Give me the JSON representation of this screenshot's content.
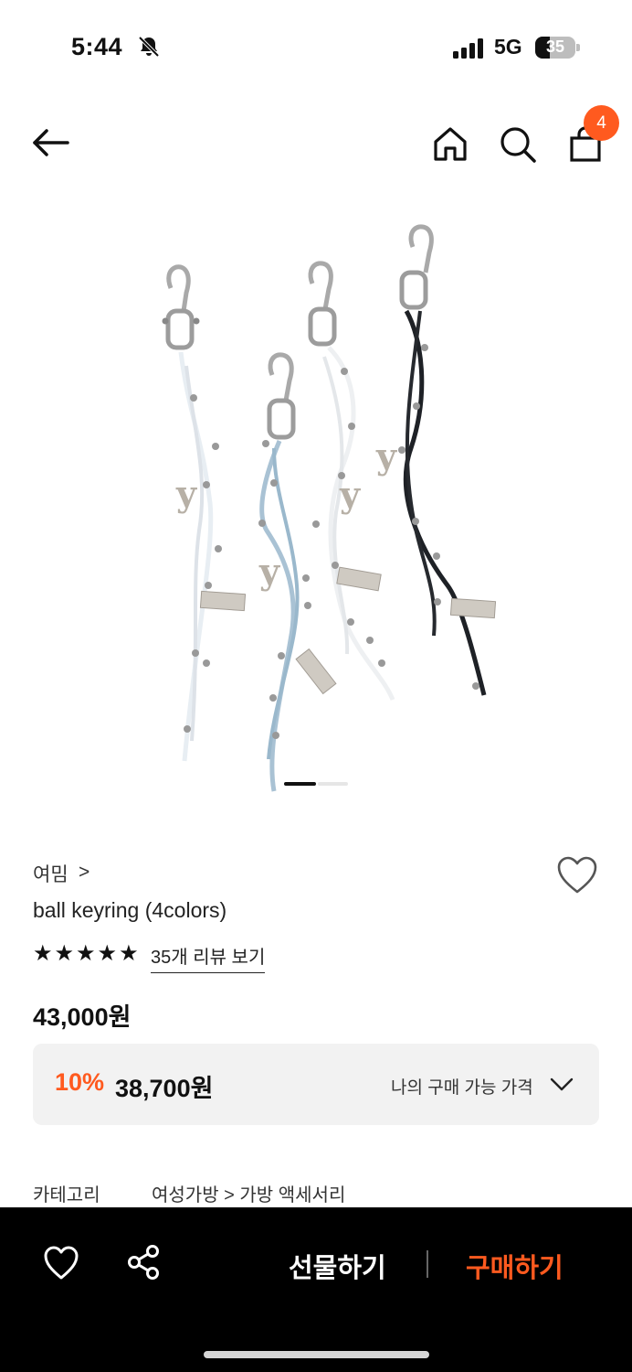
{
  "status": {
    "time": "5:44",
    "network": "5G",
    "battery": "35"
  },
  "nav": {
    "cart_count": "4"
  },
  "product": {
    "brand": "여밈",
    "brand_chevron": ">",
    "title": "ball keyring (4colors)",
    "rating": 5,
    "review_link": "35개 리뷰 보기",
    "price": "43,000원",
    "discount": "10%",
    "sale_price": "38,700원",
    "my_price_label": "나의 구매 가능 가격",
    "category_label": "카테고리",
    "category_path": "여성가방 > 가방 액세서리"
  },
  "carousel": {
    "current": 1,
    "total": 2
  },
  "bottom_bar": {
    "gift": "선물하기",
    "buy": "구매하기"
  },
  "colors": {
    "accent": "#ff5a1f",
    "bar_bg": "#000000",
    "price_box_bg": "#f2f2f2"
  }
}
